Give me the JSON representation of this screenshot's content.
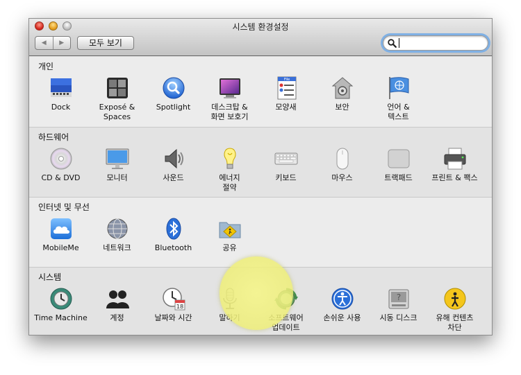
{
  "window": {
    "title": "시스템 환경설정",
    "back_arrow": "◀",
    "forward_arrow": "▶",
    "show_all_label": "모두 보기",
    "search": {
      "value": "",
      "placeholder": ""
    }
  },
  "sections": [
    {
      "title": "개인",
      "items": [
        {
          "id": "dock",
          "icon": "dock-icon",
          "label": [
            "Dock"
          ]
        },
        {
          "id": "expose-spaces",
          "icon": "expose-spaces-icon",
          "label": [
            "Exposé &",
            "Spaces"
          ]
        },
        {
          "id": "spotlight",
          "icon": "spotlight-icon",
          "label": [
            "Spotlight"
          ]
        },
        {
          "id": "desktop-screensaver",
          "icon": "desktop-screensaver-icon",
          "label": [
            "데스크탑 &",
            "화면 보호기"
          ]
        },
        {
          "id": "appearance",
          "icon": "appearance-icon",
          "label": [
            "모양새"
          ]
        },
        {
          "id": "security",
          "icon": "security-icon",
          "label": [
            "보안"
          ]
        },
        {
          "id": "language-text",
          "icon": "flag-icon",
          "label": [
            "언어 &",
            "텍스트"
          ]
        }
      ]
    },
    {
      "title": "하드웨어",
      "items": [
        {
          "id": "cd-dvd",
          "icon": "cd-dvd-icon",
          "label": [
            "CD & DVD"
          ]
        },
        {
          "id": "displays",
          "icon": "monitor-icon",
          "label": [
            "모니터"
          ]
        },
        {
          "id": "sound",
          "icon": "speaker-icon",
          "label": [
            "사운드"
          ]
        },
        {
          "id": "energy-saver",
          "icon": "lightbulb-icon",
          "label": [
            "에너지",
            "절약"
          ]
        },
        {
          "id": "keyboard",
          "icon": "keyboard-icon",
          "label": [
            "키보드"
          ]
        },
        {
          "id": "mouse",
          "icon": "mouse-icon",
          "label": [
            "마우스"
          ]
        },
        {
          "id": "trackpad",
          "icon": "trackpad-icon",
          "label": [
            "트랙패드"
          ]
        },
        {
          "id": "print-fax",
          "icon": "printer-icon",
          "label": [
            "프린트 & 팩스"
          ]
        }
      ]
    },
    {
      "title": "인터넷 및 무선",
      "items": [
        {
          "id": "mobileme",
          "icon": "cloud-icon",
          "label": [
            "MobileMe"
          ]
        },
        {
          "id": "network",
          "icon": "globe-icon",
          "label": [
            "네트워크"
          ]
        },
        {
          "id": "bluetooth",
          "icon": "bluetooth-icon",
          "label": [
            "Bluetooth"
          ]
        },
        {
          "id": "sharing",
          "icon": "sharing-folder-icon",
          "label": [
            "공유"
          ]
        }
      ]
    },
    {
      "title": "시스템",
      "items": [
        {
          "id": "time-machine",
          "icon": "time-machine-icon",
          "label": [
            "Time Machine"
          ]
        },
        {
          "id": "accounts",
          "icon": "accounts-icon",
          "label": [
            "계정"
          ]
        },
        {
          "id": "date-time",
          "icon": "clock-icon",
          "label": [
            "날짜와 시간"
          ]
        },
        {
          "id": "speech",
          "icon": "microphone-icon",
          "label": [
            "말하기"
          ]
        },
        {
          "id": "software-update",
          "icon": "software-update-icon",
          "label": [
            "소프트웨어",
            "업데이트"
          ]
        },
        {
          "id": "universal-access",
          "icon": "universal-access-icon",
          "label": [
            "손쉬운 사용"
          ]
        },
        {
          "id": "startup-disk",
          "icon": "startup-disk-icon",
          "label": [
            "시동 디스크"
          ]
        },
        {
          "id": "parental-controls",
          "icon": "parental-controls-icon",
          "label": [
            "유해 컨텐츠",
            "차단"
          ]
        }
      ]
    }
  ],
  "highlighted_item": "software-update"
}
